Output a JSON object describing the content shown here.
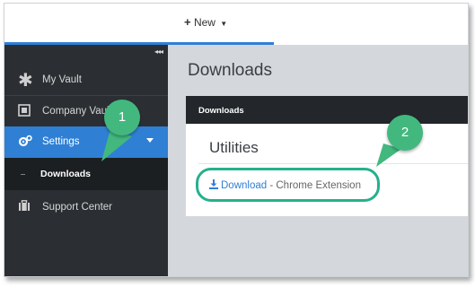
{
  "topbar": {
    "new_label": "New"
  },
  "sidebar": {
    "collapse_glyph": "◂◂◂",
    "items": [
      {
        "label": "My Vault",
        "icon": "asterisk-icon"
      },
      {
        "label": "Company Vault",
        "icon": "safe-icon"
      },
      {
        "label": "Settings",
        "icon": "gears-icon",
        "active": true
      },
      {
        "label": "Downloads",
        "sub": true,
        "active": true
      },
      {
        "label": "Support Center",
        "icon": "briefcase-icon"
      }
    ]
  },
  "main": {
    "page_title": "Downloads",
    "panel_title": "Downloads",
    "section_title": "Utilities",
    "download_link": "Download",
    "download_rest": " - Chrome Extension"
  },
  "callouts": [
    {
      "number": "1"
    },
    {
      "number": "2"
    }
  ],
  "colors": {
    "accent": "#2f80d4",
    "callout": "#42b87f",
    "sidebar": "#2b2f33",
    "panel_header": "#23272b"
  }
}
